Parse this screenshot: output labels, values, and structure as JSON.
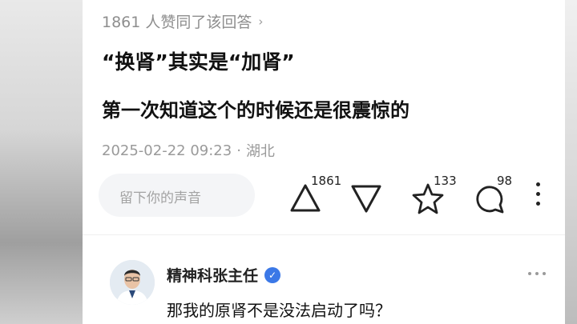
{
  "answer": {
    "likes_summary": "1861 人赞同了该回答",
    "title": "“换肾”其实是“加肾”",
    "body": "第一次知道这个的时候还是很震惊的",
    "timestamp": "2025-02-22 09:23",
    "separator": "·",
    "location": "湖北"
  },
  "comment_input": {
    "placeholder": "留下你的声音"
  },
  "actions": {
    "upvote_count": "1861",
    "favorite_count": "133",
    "comment_count": "98"
  },
  "reply": {
    "username": "精神科张主任",
    "text": "那我的原肾不是没法启动了吗？"
  },
  "icons": {
    "likes_chevron": "chevron-right-icon",
    "upvote": "upvote-triangle-icon",
    "downvote": "downvote-triangle-icon",
    "favorite": "star-icon",
    "comment": "comment-bubble-icon",
    "more": "more-vertical-icon",
    "reply_more": "more-horizontal-icon",
    "verified": "verified-badge-icon"
  },
  "colors": {
    "accent": "#3b78e7",
    "muted_text": "#9a9a9a"
  }
}
